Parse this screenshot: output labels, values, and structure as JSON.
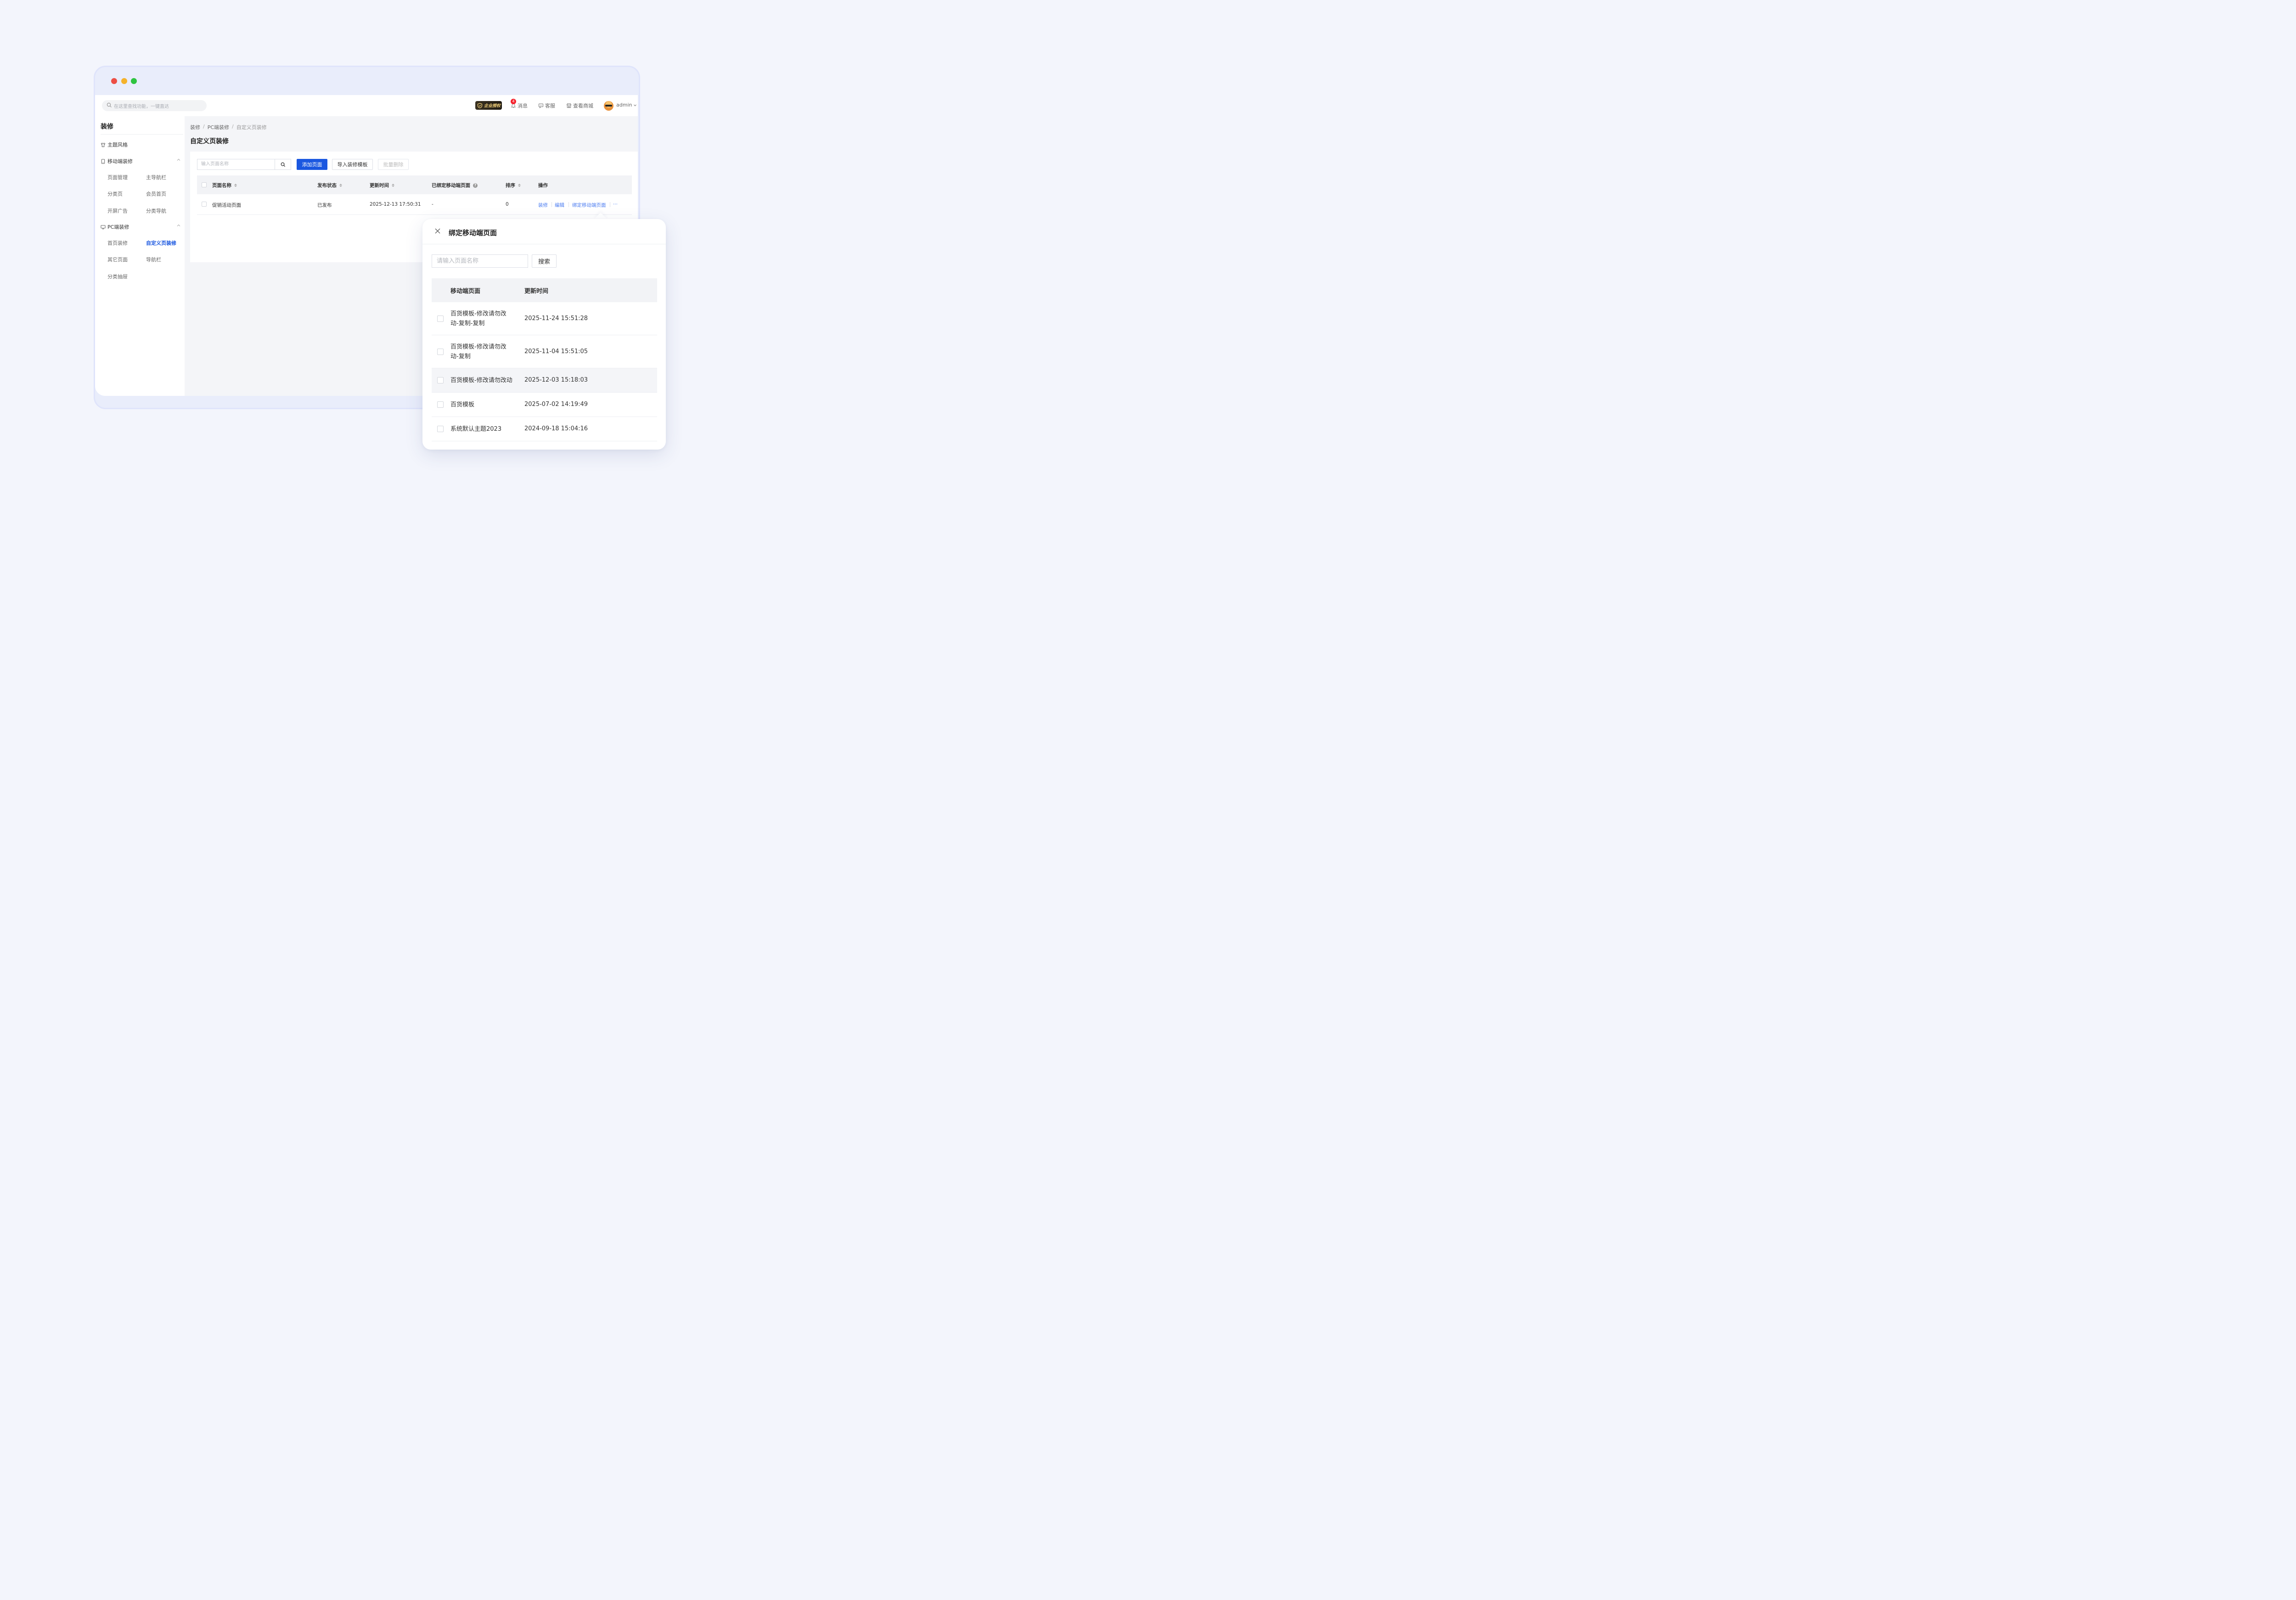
{
  "header": {
    "search_placeholder": "在这里查找功能，一键直达",
    "auth_badge": "企业授权",
    "notification_count": "4",
    "messages": "消息",
    "service": "客服",
    "view_store": "查看商城",
    "user": "admin"
  },
  "sidebar": {
    "title": "装修",
    "theme": "主题风格",
    "mobile_group": "移动端装修",
    "mobile_items": [
      "页面管理",
      "主导航栏",
      "分类页",
      "会员首页",
      "开屏广告",
      "分类导航"
    ],
    "pc_group": "PC端装修",
    "pc_items": [
      "首页装修",
      "自定义页装修",
      "其它页面",
      "导航栏",
      "分类抽屉"
    ]
  },
  "breadcrumb": [
    "装修",
    "PC端装修",
    "自定义页装修"
  ],
  "breadcrumb_sep": "/",
  "page_title": "自定义页装修",
  "toolbar": {
    "search_placeholder": "输入页面名称",
    "add_page": "添加页面",
    "import_template": "导入装修模板",
    "batch_delete": "批量删除"
  },
  "table": {
    "columns": [
      "页面名称",
      "发布状态",
      "更新时间",
      "已绑定移动端页面",
      "排序",
      "操作"
    ],
    "rows": [
      {
        "name": "促销活动页面",
        "status": "已发布",
        "updated": "2025-12-13 17:50:31",
        "bound": "-",
        "order": "0",
        "actions": [
          "装修",
          "编辑",
          "绑定移动端页面",
          "···"
        ]
      }
    ]
  },
  "popover": {
    "title": "绑定移动端页面",
    "search_placeholder": "请输入页面名称",
    "search_button": "搜索",
    "columns": [
      "移动端页面",
      "更新时间"
    ],
    "rows": [
      {
        "name": "百货模板-修改请勿改动-复制-复制",
        "time": "2025-11-24 15:51:28"
      },
      {
        "name": "百货模板-修改请勿改动-复制",
        "time": "2025-11-04 15:51:05"
      },
      {
        "name": "百货模板-修改请勿改动",
        "time": "2025-12-03 15:18:03"
      },
      {
        "name": "百货模板",
        "time": "2025-07-02 14:19:49"
      },
      {
        "name": "系统默认主题2023",
        "time": "2024-09-18 15:04:16"
      }
    ]
  },
  "colors": {
    "primary": "#1a57e0",
    "link": "#4b7cf0",
    "badge_red": "#f5222d",
    "traffic_red": "#ed4e45",
    "traffic_yellow": "#f5b22b",
    "traffic_green": "#2ec440"
  }
}
